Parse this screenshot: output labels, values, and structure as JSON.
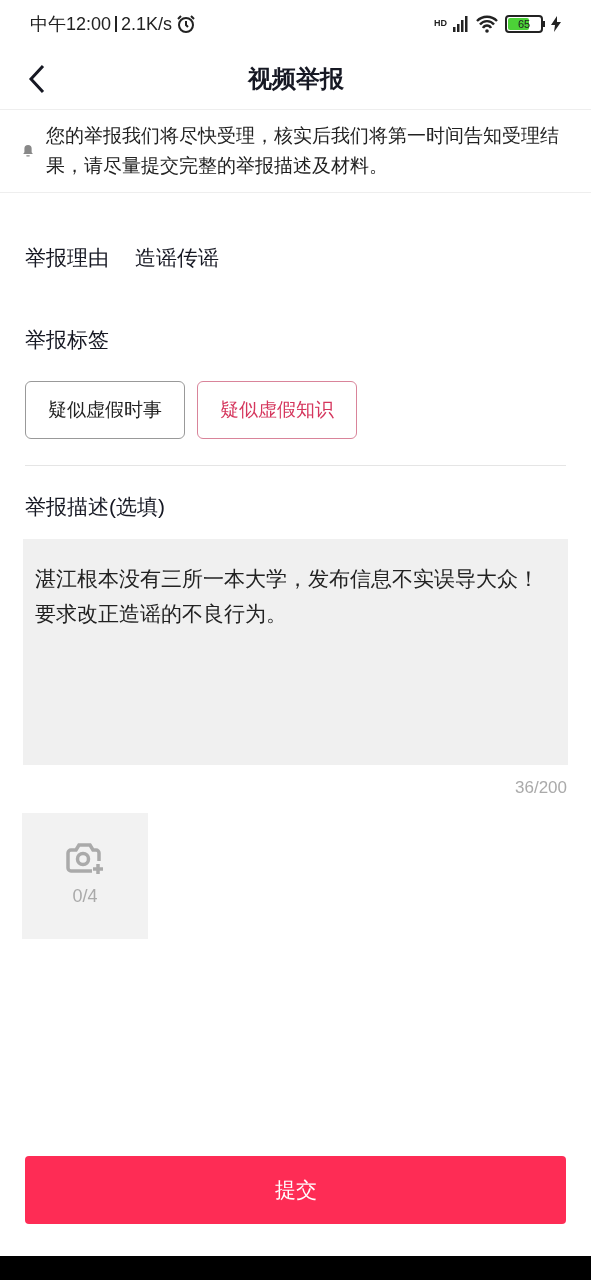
{
  "status_bar": {
    "time": "中午12:00",
    "speed": "2.1K/s",
    "network": "HD",
    "battery": "65"
  },
  "header": {
    "title": "视频举报"
  },
  "notice": {
    "text": "您的举报我们将尽快受理，核实后我们将第一时间告知受理结果，请尽量提交完整的举报描述及材料。"
  },
  "reason": {
    "label": "举报理由",
    "value": "造谣传谣"
  },
  "tags": {
    "label": "举报标签",
    "items": [
      {
        "label": "疑似虚假时事",
        "selected": false
      },
      {
        "label": "疑似虚假知识",
        "selected": true
      }
    ]
  },
  "description": {
    "label": "举报描述(选填)",
    "value": "湛江根本没有三所一本大学，发布信息不实误导大众！要求改正造谣的不良行为。",
    "count": "36/200"
  },
  "upload": {
    "count": "0/4"
  },
  "submit": {
    "label": "提交"
  }
}
